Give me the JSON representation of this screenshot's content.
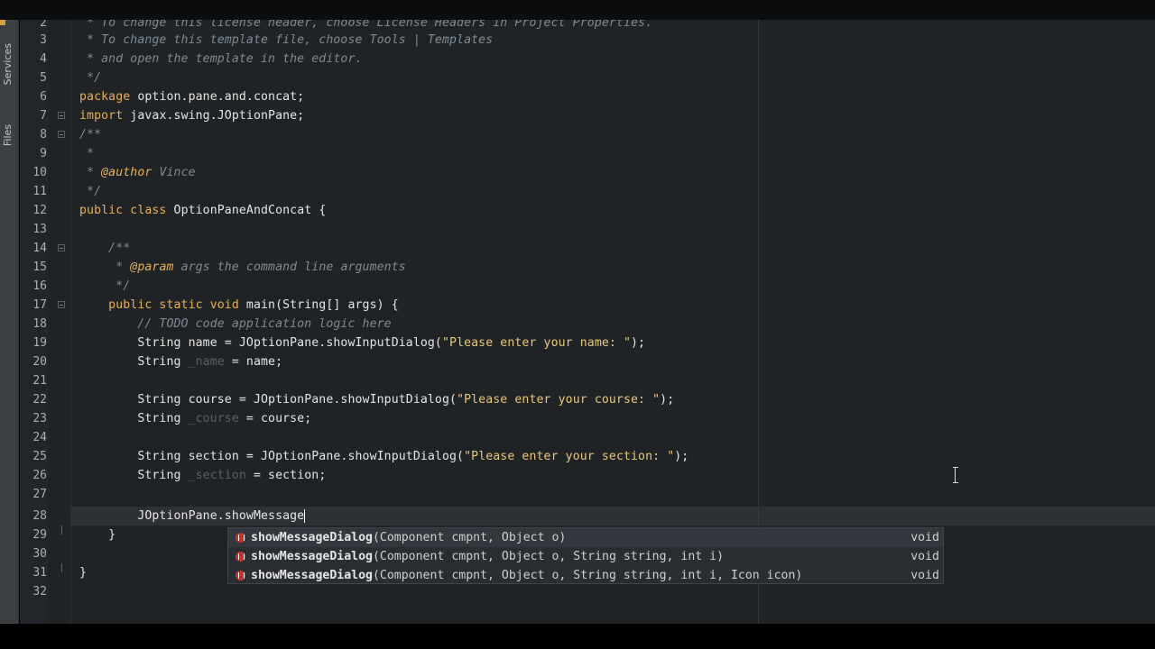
{
  "side_tabs": {
    "services": "Services",
    "files": "Files"
  },
  "colors": {
    "editor_bg": "#1f2326",
    "keyword": "#e9b15a",
    "string": "#e8c77a",
    "comment": "#7f8b95",
    "caret_line": "#2d3136"
  },
  "lines": {
    "l2": {
      "n": "2",
      "text": " * To change this license header, choose License Headers in Project Properties."
    },
    "l3": {
      "n": "3",
      "text": " * To change this template file, choose Tools | Templates"
    },
    "l4": {
      "n": "4",
      "text": " * and open the template in the editor."
    },
    "l5": {
      "n": "5",
      "text": " */"
    },
    "l6": {
      "n": "6",
      "kw": "package",
      "rest": " option.pane.and.concat;"
    },
    "l7": {
      "n": "7",
      "kw": "import",
      "rest": " javax.swing.JOptionPane;"
    },
    "l8": {
      "n": "8",
      "text": "/**"
    },
    "l9": {
      "n": "9",
      "text": " *"
    },
    "l10": {
      "n": "10",
      "pre": " * ",
      "tag": "@author",
      "post": " Vince"
    },
    "l11": {
      "n": "11",
      "text": " */"
    },
    "l12": {
      "n": "12",
      "kw": "public class",
      "rest": " OptionPaneAndConcat {"
    },
    "l13": {
      "n": "13"
    },
    "l14": {
      "n": "14",
      "text": "    /**"
    },
    "l15": {
      "n": "15",
      "pre": "     * ",
      "tag": "@param",
      "post": " args the command line arguments"
    },
    "l16": {
      "n": "16",
      "text": "     */"
    },
    "l17": {
      "n": "17",
      "kw": "    public static void",
      "rest": " main(String[] args) {"
    },
    "l18": {
      "n": "18",
      "text": "        // TODO code application logic here"
    },
    "l19": {
      "n": "19",
      "a": "        String name = JOptionPane.showInputDialog(",
      "s": "\"Please enter your name: \"",
      "b": ");"
    },
    "l20": {
      "n": "20",
      "a": "        String ",
      "d": "_name",
      "b": " = name;"
    },
    "l21": {
      "n": "21"
    },
    "l22": {
      "n": "22",
      "a": "        String course = JOptionPane.showInputDialog(",
      "s": "\"Please enter your course: \"",
      "b": ");"
    },
    "l23": {
      "n": "23",
      "a": "        String ",
      "d": "_course",
      "b": " = course;"
    },
    "l24": {
      "n": "24"
    },
    "l25": {
      "n": "25",
      "a": "        String section = JOptionPane.showInputDialog(",
      "s": "\"Please enter your section: \"",
      "b": ");"
    },
    "l26": {
      "n": "26",
      "a": "        String ",
      "d": "_section",
      "b": " = section;"
    },
    "l27": {
      "n": "27"
    },
    "l28": {
      "n": "28",
      "text": "        JOptionPane.showMessage"
    },
    "l29": {
      "n": "29",
      "text": "    }"
    },
    "l30": {
      "n": "30"
    },
    "l31": {
      "n": "31",
      "text": "}"
    },
    "l32": {
      "n": "32"
    }
  },
  "completion": [
    {
      "name": "showMessageDialog",
      "params": "(Component cmpnt, Object o)",
      "ret": "void"
    },
    {
      "name": "showMessageDialog",
      "params": "(Component cmpnt, Object o, String string, int i)",
      "ret": "void"
    },
    {
      "name": "showMessageDialog",
      "params": "(Component cmpnt, Object o, String string, int i, Icon icon)",
      "ret": "void"
    }
  ]
}
